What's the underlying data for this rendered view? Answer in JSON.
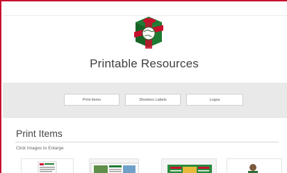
{
  "header": {
    "logo_icon": "shoebox-globe-logo-icon",
    "title": "Printable Resources"
  },
  "tabs": [
    {
      "label": "Print Items"
    },
    {
      "label": "Shoebox Labels"
    },
    {
      "label": "Logos"
    }
  ],
  "section": {
    "title": "Print Items",
    "subtitle": "Click Images to Enlarge"
  },
  "thumbnails": [
    {
      "icon": "print-item-document-thumbnail"
    },
    {
      "icon": "print-item-brochure-thumbnail"
    },
    {
      "icon": "print-item-flyer-thumbnail"
    },
    {
      "icon": "print-item-photo-thumbnail"
    }
  ],
  "colors": {
    "frame_red": "#c8102e",
    "logo_green": "#1e7a32",
    "logo_red": "#c8102e",
    "band_gray": "#e9e9e9"
  }
}
